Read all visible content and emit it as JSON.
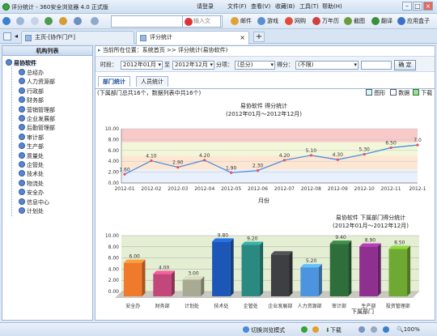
{
  "window": {
    "title": "评分统计 - 360安全浏览器 4.0 正式版",
    "menu": [
      "请登录",
      "文件(F)",
      "查看(V)",
      "收藏(B)",
      "工具(T)",
      "帮助(H)"
    ]
  },
  "toolbar": {
    "search_placeholder": "输入文",
    "links": [
      "邮件",
      "游戏",
      "网购",
      "万年历",
      "截图",
      "翻译",
      "应用盒子"
    ]
  },
  "tabs": [
    {
      "label": "主页-[协作门户]"
    },
    {
      "label": "评分统计",
      "active": true
    }
  ],
  "left": {
    "title": "机构列表",
    "root": "易协软件",
    "items": [
      "总经办",
      "人力资源部",
      "行政部",
      "财务部",
      "营销管理部",
      "企业发展部",
      "后勤管理部",
      "审计部",
      "生产部",
      "质量处",
      "企管处",
      "技术处",
      "物流处",
      "安全办",
      "信息中心",
      "计划处"
    ]
  },
  "main": {
    "breadcrumb": "当前所在位置：系统首页 >> 评分统计(易协软件)",
    "filter": {
      "label_period": "时段：",
      "from": "2012年01月",
      "sep": "至",
      "to": "2012年12月",
      "label_score": "分项：",
      "score_value": "(总分)",
      "label_get": "得分：",
      "get_value": "(不限)",
      "ok": "确 定"
    },
    "subtabs": [
      "部门统计",
      "人员统计"
    ],
    "info": "(下属部门总共16个，数据列表中共16个)",
    "view_icons": [
      "图形",
      "数据",
      "下载"
    ]
  },
  "statusbar": {
    "mode": "切换浏览模式",
    "download": "下载",
    "zoom": "100%"
  },
  "chart_data": [
    {
      "type": "line",
      "title": "易协软件  得分统计",
      "subtitle": "(2012年01月～2012年12月)",
      "xlabel": "月份",
      "ylabel": "",
      "categories": [
        "2012-01",
        "2012-02",
        "2012-03",
        "2012-04",
        "2012-05",
        "2012-06",
        "2012-07",
        "2012-08",
        "2012-09",
        "2012-10",
        "2012-11",
        "2012-1"
      ],
      "values": [
        1.6,
        4.1,
        2.9,
        4.2,
        1.9,
        2.3,
        4.2,
        5.1,
        4.3,
        5.3,
        6.5,
        7.0
      ],
      "value_labels": [
        "1.60",
        "4.10",
        "2.90",
        "4.20",
        "1.90",
        "2.30",
        "4.20",
        "5.10",
        "4.30",
        "5.30",
        "6.50",
        "7.0"
      ],
      "ylim": [
        0,
        10
      ],
      "yticks": [
        "0.00",
        "2.00",
        "4.00",
        "6.00",
        "8.00",
        "10.00"
      ],
      "grid": true,
      "bands": [
        "#f7c9c9",
        "#f2f7d9",
        "#fde6d2",
        "#e7f0fb"
      ]
    },
    {
      "type": "bar",
      "title": "易协软件  下属部门得分统计",
      "subtitle": "(2012年01月～2012年12月)",
      "xlabel": "下属部门",
      "ylabel": "",
      "categories": [
        "安全办",
        "财务部",
        "计划处",
        "技术处",
        "企管处",
        "企业发展部",
        "人力资源部",
        "审计部",
        "生产部",
        "投资管理部"
      ],
      "values": [
        6.0,
        4.0,
        3.0,
        9.8,
        9.2,
        7.5,
        5.2,
        9.4,
        8.9,
        8.5
      ],
      "value_labels": [
        "6.00",
        "4.00",
        "3.00",
        "9.80",
        "9.20",
        "",
        "5.20",
        "9.40",
        "8.90",
        "8.50"
      ],
      "colors": [
        "#f07a2c",
        "#c2477b",
        "#a8aa94",
        "#1c57b8",
        "#2a8a82",
        "#3d3f42",
        "#4d94de",
        "#2e6e3a",
        "#8f2f8f",
        "#6fa832"
      ],
      "ylim": [
        0,
        10
      ],
      "yticks": [
        "0.00",
        "2.00",
        "4.00",
        "6.00",
        "8.00",
        "10.00"
      ],
      "grid": true
    }
  ]
}
